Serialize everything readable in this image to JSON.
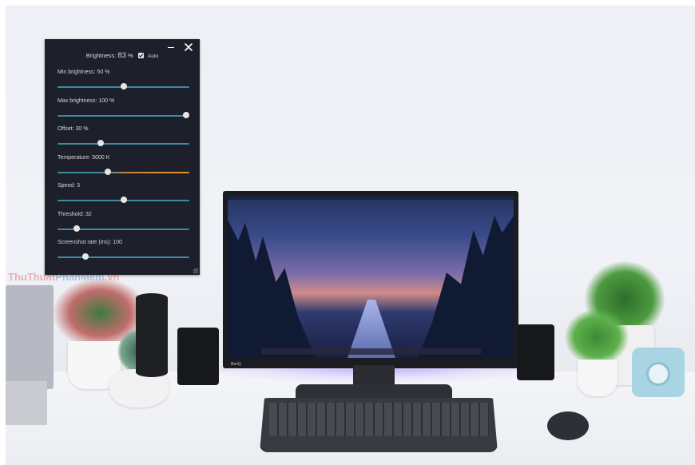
{
  "window": {
    "header": {
      "label": "Brightness:",
      "value": "83",
      "unit": "%",
      "auto_checked": true,
      "auto_label": "Auto"
    },
    "controls": {
      "minimize_icon": "minimize-icon",
      "close_icon": "close-icon"
    },
    "sliders": [
      {
        "label": "Min brightness:",
        "value_text": "50",
        "unit": "%",
        "value": 50,
        "min": 0,
        "max": 100
      },
      {
        "label": "Max brightness:",
        "value_text": "100",
        "unit": "%",
        "value": 100,
        "min": 0,
        "max": 100
      },
      {
        "label": "Offset:",
        "value_text": "30",
        "unit": "%",
        "value": 30,
        "min": -50,
        "max": 200
      },
      {
        "label": "Temperature:",
        "value_text": "5000",
        "unit": "K",
        "value": 5000,
        "min": 2000,
        "max": 10000
      },
      {
        "label": "Speed:",
        "value_text": "3",
        "unit": "",
        "value": 3,
        "min": 1,
        "max": 5
      },
      {
        "label": "Threshold:",
        "value_text": "32",
        "unit": "",
        "value": 32,
        "min": 0,
        "max": 250
      },
      {
        "label": "Screenshot rate (ms):",
        "value_text": "100",
        "unit": "",
        "value": 100,
        "min": 0,
        "max": 500
      }
    ],
    "colors": {
      "background": "#1d1f2a",
      "track": "#3e8aa3",
      "warm": "#e9902a",
      "knob": "#e6e6e6"
    }
  },
  "watermark": {
    "part1": "ThuThuat",
    "part2": "PhanMem",
    "part3": ".vn"
  },
  "monitor": {
    "brand": "BenQ"
  }
}
